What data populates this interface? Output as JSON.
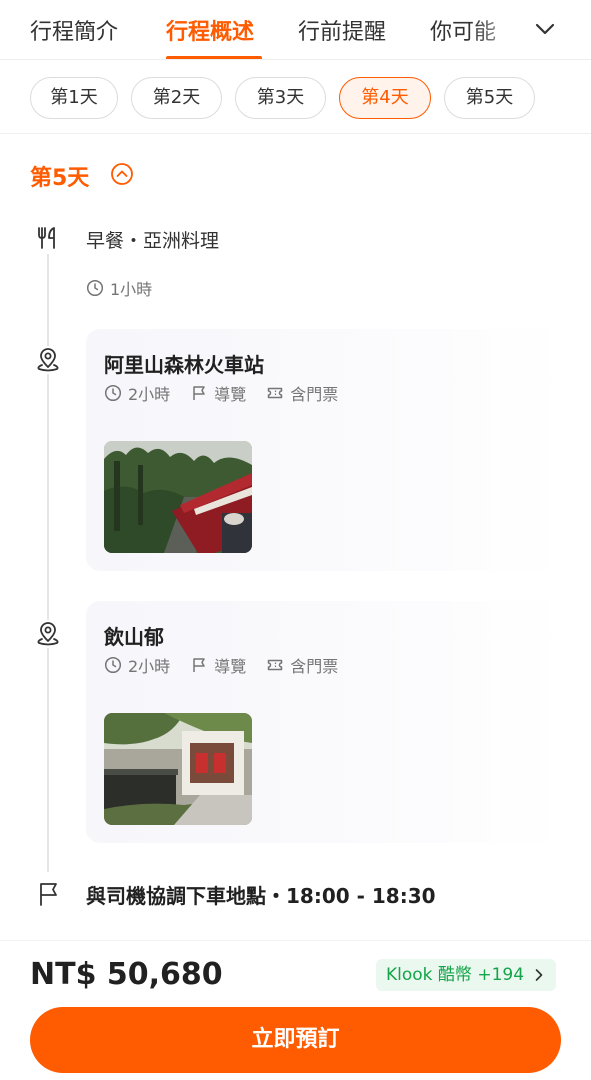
{
  "tabs": [
    {
      "label": "行程簡介",
      "active": false
    },
    {
      "label": "行程概述",
      "active": true
    },
    {
      "label": "行前提醒",
      "active": false
    },
    {
      "label": "你可能",
      "active": false
    }
  ],
  "day_chips": [
    {
      "label": "第1天",
      "active": false
    },
    {
      "label": "第2天",
      "active": false
    },
    {
      "label": "第3天",
      "active": false
    },
    {
      "label": "第4天",
      "active": true
    },
    {
      "label": "第5天",
      "active": false
    }
  ],
  "day_section": {
    "title": "第5天",
    "meal": {
      "title": "早餐・亞洲料理",
      "duration": "1小時"
    },
    "activities": [
      {
        "title": "阿里山森林火車站",
        "duration": "2小時",
        "guide": "導覽",
        "ticket": "含門票"
      },
      {
        "title": "飲山郁",
        "duration": "2小時",
        "guide": "導覽",
        "ticket": "含門票"
      }
    ],
    "end_point": "與司機協調下車地點・18:00 - 18:30"
  },
  "bottom_bar": {
    "price": "NT$ 50,680",
    "credits": "Klook 酷幣 +194",
    "book_label": "立即預訂"
  },
  "colors": {
    "accent": "#ff5b00",
    "credits_green": "#16a34a",
    "credits_bg": "#eaf8ef"
  },
  "icons": [
    "chevron-down-icon",
    "chevron-up-circle-icon",
    "utensils-icon",
    "clock-icon",
    "location-pin-icon",
    "flag-icon",
    "ticket-icon",
    "chevron-right-icon"
  ]
}
